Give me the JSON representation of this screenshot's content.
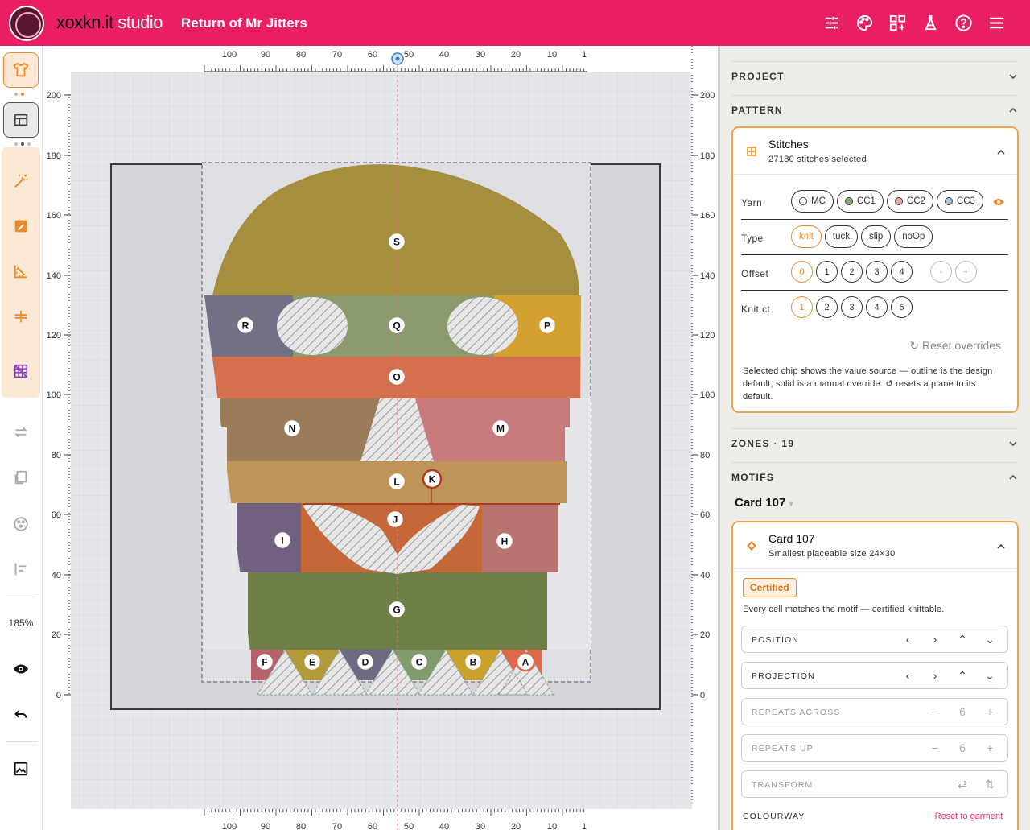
{
  "app": {
    "brand_prefix": "xoxkn.it",
    "brand_suffix": "studio",
    "title": "Return of Mr Jitters"
  },
  "header_icons": [
    "sliders-icon",
    "palette-icon",
    "grid-add-icon",
    "flask-icon",
    "help-icon",
    "menu-icon"
  ],
  "toolbar": {
    "zoom": "185%"
  },
  "rulers": {
    "top": [
      "100",
      "90",
      "80",
      "70",
      "60",
      "50",
      "40",
      "30",
      "20",
      "10",
      "1"
    ],
    "left": [
      "200",
      "180",
      "160",
      "140",
      "120",
      "100",
      "80",
      "60",
      "40",
      "20",
      "0"
    ]
  },
  "zones": [
    "A",
    "B",
    "C",
    "D",
    "E",
    "F",
    "G",
    "H",
    "I",
    "J",
    "K",
    "L",
    "M",
    "N",
    "O",
    "P",
    "Q",
    "R",
    "S"
  ],
  "panel": {
    "project_label": "PROJECT",
    "pattern_label": "PATTERN",
    "stitches": {
      "title": "Stitches",
      "subtitle": "27180 stitches selected",
      "yarn_label": "Yarn",
      "yarns": [
        {
          "label": "MC",
          "color": "#ffffff"
        },
        {
          "label": "CC1",
          "color": "#7fae6c"
        },
        {
          "label": "CC2",
          "color": "#f4a3a3"
        },
        {
          "label": "CC3",
          "color": "#a7c7dc"
        }
      ],
      "type_label": "Type",
      "types": [
        "knit",
        "tuck",
        "slip",
        "noOp"
      ],
      "offset_label": "Offset",
      "offsets": [
        "0",
        "1",
        "2",
        "3",
        "4"
      ],
      "offset_step": [
        "-",
        "+"
      ],
      "knitct_label": "Knit ct",
      "knitcts": [
        "1",
        "2",
        "3",
        "4",
        "5"
      ],
      "reset": "Reset overrides",
      "help": "Selected chip shows the value source — outline is the design default, solid is a manual override. ↺ resets a plane to its default."
    },
    "zones_label": "ZONES · 19",
    "motifs_label": "MOTIFS",
    "motif_select": "Card 107",
    "motif": {
      "title": "Card 107",
      "subtitle": "Smallest placeable size 24×30",
      "badge": "Certified",
      "desc": "Every cell matches the motif — certified knittable.",
      "position": "POSITION",
      "projection": "PROJECTION",
      "repeats_across": "REPEATS ACROSS",
      "repeats_across_value": "6",
      "repeats_up": "REPEATS UP",
      "repeats_up_value": "6",
      "transform": "TRANSFORM",
      "colourway": "COLOURWAY",
      "reset_garment": "Reset to garment"
    }
  },
  "colors": {
    "accent": "#e91e63",
    "highlight": "#ee8a2a",
    "zone_a": "#dc6a4b",
    "zone_b": "#c9a12b",
    "zone_c": "#7f9a6b",
    "zone_d": "#6e6a83",
    "zone_e": "#b49a3a",
    "zone_f": "#b6626a",
    "zone_g": "#6f7f48",
    "zone_h": "#b8726f",
    "zone_i": "#726080",
    "zone_j": "#c4683a",
    "zone_l": "#bf9458",
    "zone_m": "#c97a7d",
    "zone_n": "#9b7c58",
    "zone_o": "#d4704e",
    "zone_p": "#d2a12f",
    "zone_q": "#8a9a6c",
    "zone_r": "#727085",
    "zone_s": "#a58e3d"
  }
}
